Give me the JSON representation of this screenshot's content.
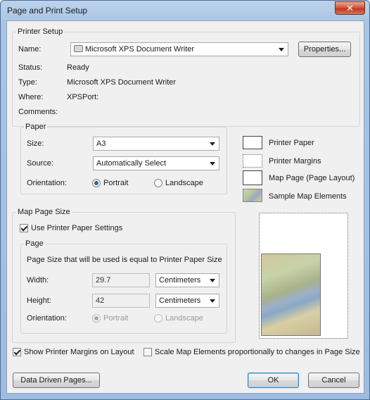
{
  "window": {
    "title": "Page and Print Setup",
    "close_label": "✕"
  },
  "printer_setup": {
    "legend": "Printer Setup",
    "name_label": "Name:",
    "name_value": "Microsoft XPS Document Writer",
    "properties_button": "Properties...",
    "status_label": "Status:",
    "status_value": "Ready",
    "type_label": "Type:",
    "type_value": "Microsoft XPS Document Writer",
    "where_label": "Where:",
    "where_value": "XPSPort:",
    "comments_label": "Comments:"
  },
  "paper": {
    "legend": "Paper",
    "size_label": "Size:",
    "size_value": "A3",
    "source_label": "Source:",
    "source_value": "Automatically Select",
    "orientation_label": "Orientation:",
    "portrait": "Portrait",
    "landscape": "Landscape",
    "selected_orientation": "Portrait"
  },
  "legend_items": {
    "printer_paper": "Printer Paper",
    "printer_margins": "Printer Margins",
    "map_page": "Map Page (Page Layout)",
    "sample_map": "Sample Map Elements"
  },
  "map_page_size": {
    "legend": "Map Page Size",
    "use_printer_paper": "Use Printer Paper Settings",
    "use_printer_paper_checked": true,
    "page_legend": "Page",
    "page_info": "Page Size that will be used is equal to Printer Paper Size",
    "width_label": "Width:",
    "width_value": "29.7",
    "width_unit": "Centimeters",
    "height_label": "Height:",
    "height_value": "42",
    "height_unit": "Centimeters",
    "orientation_label": "Orientation:",
    "portrait": "Portrait",
    "landscape": "Landscape"
  },
  "options": {
    "show_margins": "Show Printer Margins on Layout",
    "show_margins_checked": true,
    "scale_elements": "Scale Map Elements proportionally to changes in Page Size",
    "scale_elements_checked": false
  },
  "buttons": {
    "data_driven": "Data Driven Pages...",
    "ok": "OK",
    "cancel": "Cancel"
  },
  "colors": {
    "accent": "#2a6b9a",
    "titlebar": "#a9c4e4",
    "close": "#c0391f"
  }
}
